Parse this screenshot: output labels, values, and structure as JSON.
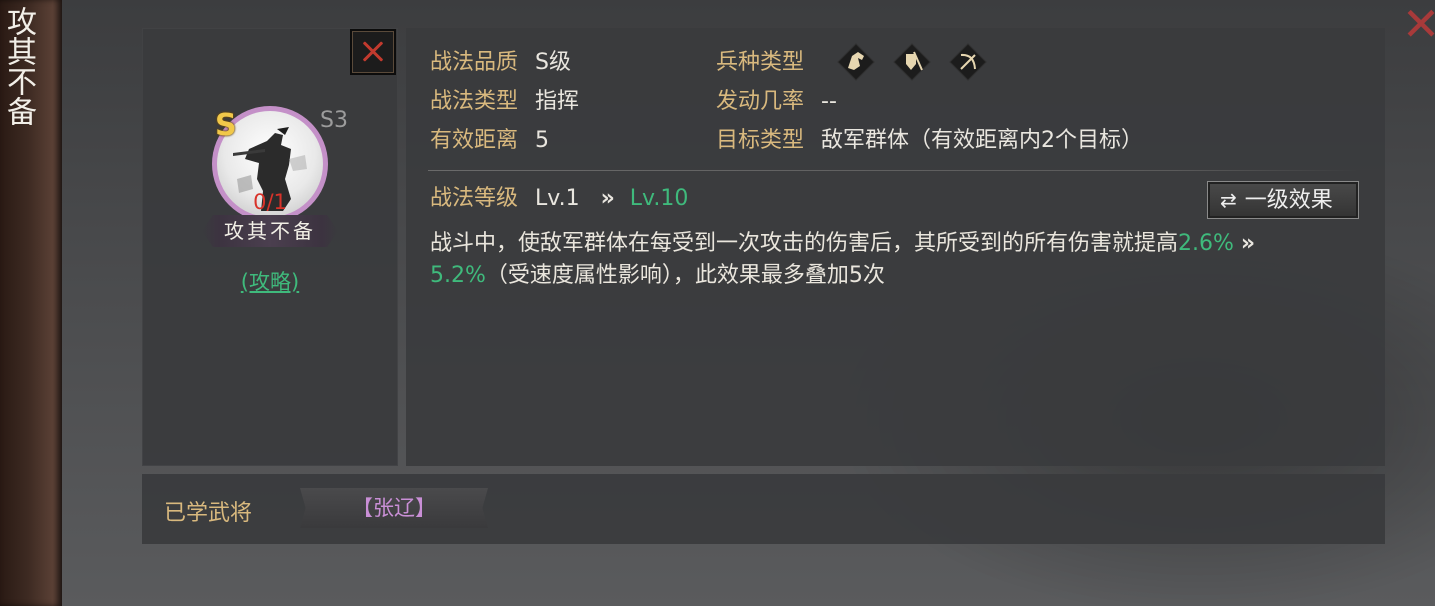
{
  "side": {
    "title": "攻其不备"
  },
  "skill": {
    "grade_badge": "S",
    "season": "S3",
    "count": "0/1",
    "name": "攻其不备",
    "strategy_link": "(攻略)"
  },
  "info": {
    "quality_label": "战法品质",
    "quality_value": "S级",
    "type_label": "战法类型",
    "type_value": "指挥",
    "range_label": "有效距离",
    "range_value": "5",
    "troop_label": "兵种类型",
    "troop_icons": [
      "cavalry-icon",
      "shield-infantry-icon",
      "archer-icon"
    ],
    "trigger_label": "发动几率",
    "trigger_value": "--",
    "target_label": "目标类型",
    "target_value": "敌军群体（有效距离内2个目标）"
  },
  "level": {
    "label": "战法等级",
    "from": "Lv.1",
    "arrow": "»",
    "to": "Lv.10",
    "effect_button": "一级效果"
  },
  "description": {
    "part1": "战斗中，使敌军群体在每受到一次攻击的伤害后，其所受到的所有伤害就提高",
    "value_from": "2.6%",
    "arrow": "»",
    "value_to": "5.2%",
    "part2": "（受速度属性影响），此效果最多叠加5次"
  },
  "learned": {
    "label": "已学武将",
    "generals": [
      "【张辽】"
    ]
  },
  "colors": {
    "label_gold": "#d9b97e",
    "value_green": "#3fba7c",
    "count_red": "#d8332a",
    "general_purple": "#c98fd6",
    "close_red": "#c23a2e"
  }
}
